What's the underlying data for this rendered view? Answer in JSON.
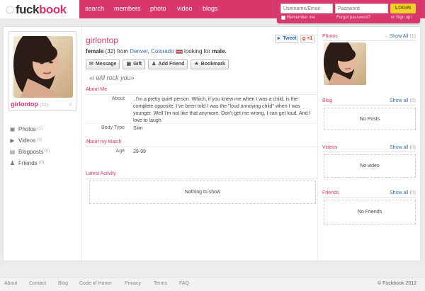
{
  "brand": {
    "prefix": "fuck",
    "suffix": "book"
  },
  "nav": [
    "search",
    "members",
    "photo",
    "video",
    "blogs"
  ],
  "login": {
    "username_placeholder": "Username/Email",
    "password_placeholder": "Password",
    "login_label": "LOGIN",
    "remember_label": "Remember me",
    "forgot_label": "Forgot password?",
    "signup_label": "or Sign up!"
  },
  "profile": {
    "name": "girlontop",
    "age_badge": "(32)",
    "gender": "female",
    "age": "(32)",
    "from_word": "from",
    "city": "Denver",
    "state": "Colorado",
    "looking_for": "looking for",
    "looking_gender": "male.",
    "quote": "«i will rock you»",
    "tweet_label": "Tweet",
    "gplus_label": "+1"
  },
  "actions": [
    {
      "icon": "envelope-icon",
      "label": "Message"
    },
    {
      "icon": "gift-icon",
      "label": "Gift"
    },
    {
      "icon": "add-friend-icon",
      "label": "Add Friend"
    },
    {
      "icon": "star-icon",
      "label": "Bookmark"
    }
  ],
  "sidebar": [
    {
      "icon": "camera-icon",
      "label": "Photos",
      "count": "(1)"
    },
    {
      "icon": "video-icon",
      "label": "Videos",
      "count": "(0)"
    },
    {
      "icon": "document-icon",
      "label": "Blogposts",
      "count": "(0)"
    },
    {
      "icon": "friends-icon",
      "label": "Friends",
      "count": "(0)"
    }
  ],
  "about_me": {
    "title": "About Me",
    "about_label": "About",
    "about_text": "..I'm a pretty quiet person. Which, if you knew me when I was a child, is the complete opposite. I've been told I was the \"loud annoying child\" when I was younger. Well I'm not like that anymore. Don't get me wrong, I can get loud. And I love to laugh.",
    "body_label": "Body Type",
    "body_value": "Slim"
  },
  "match": {
    "title": "About my Match",
    "age_label": "Age",
    "age_value": "29-99"
  },
  "activity": {
    "title": "Latest Activity",
    "empty": "Nothing to show"
  },
  "right": {
    "photos": {
      "title": "Photos",
      "show": "Show All",
      "count": "(1)"
    },
    "blog": {
      "title": "Blog",
      "show": "Show all",
      "count": "(0)",
      "empty": "No Posts"
    },
    "videos": {
      "title": "Videos",
      "show": "Show all",
      "count": "(0)",
      "empty": "No video"
    },
    "friends": {
      "title": "Friends",
      "show": "Show all",
      "count": "(0)",
      "empty": "No Friends"
    }
  },
  "footer": {
    "links": [
      "About",
      "Contact",
      "Blog",
      "Code of Honor",
      "Privacy",
      "Terms",
      "FAQ"
    ],
    "copyright": "© Fuckbook 2012"
  }
}
